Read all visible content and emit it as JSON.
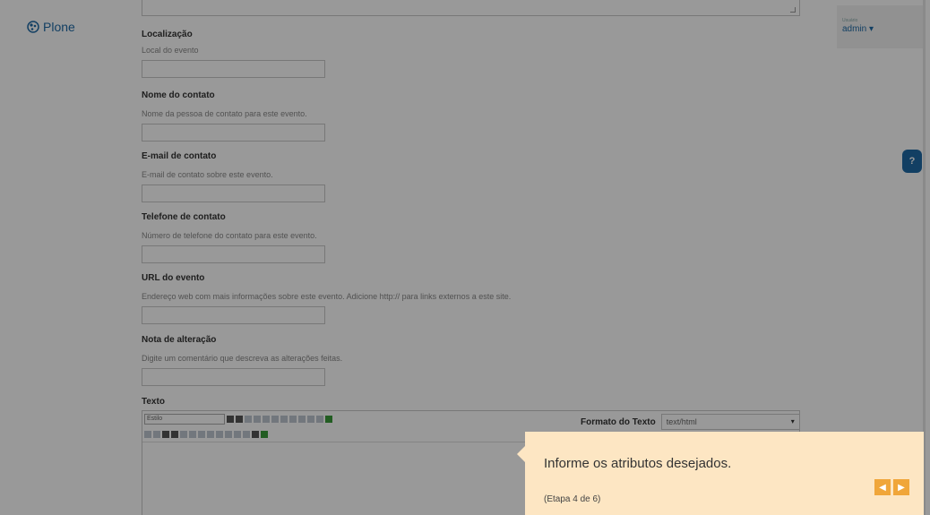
{
  "logo": {
    "text": "Plone"
  },
  "user": {
    "label": "Usuário",
    "name": "admin ▾"
  },
  "help_button": {
    "glyph": "?"
  },
  "fields": [
    {
      "label": "Localização",
      "help": "Local do evento"
    },
    {
      "label": "Nome do contato",
      "help": "Nome da pessoa de contato para este evento."
    },
    {
      "label": "E-mail de contato",
      "help": "E-mail de contato sobre este evento."
    },
    {
      "label": "Telefone de contato",
      "help": "Número de telefone do contato para este evento."
    },
    {
      "label": "URL do evento",
      "help": "Endereço web com mais informações sobre este evento. Adicione http:// para links externos a este site."
    },
    {
      "label": "Nota de alteração",
      "help": "Digite um comentário que descreva as alterações feitas."
    }
  ],
  "texto": {
    "label": "Texto",
    "style_select": "Estilo",
    "format_label": "Formato do Texto",
    "format_value": "text/html"
  },
  "tour": {
    "message": "Informe os atributos desejados.",
    "step": "(Etapa 4 de 6)",
    "prev_glyph": "◀",
    "next_glyph": "▶"
  }
}
